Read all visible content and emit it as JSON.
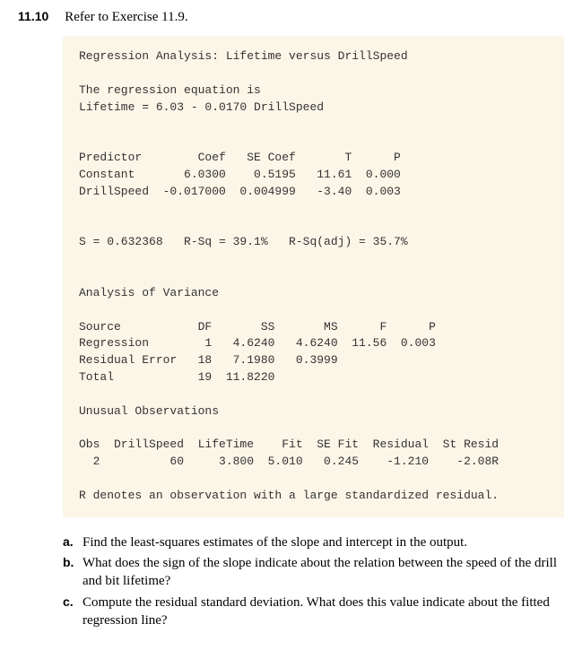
{
  "exercise": {
    "number": "11.10",
    "reference": "Refer to Exercise 11.9."
  },
  "output": {
    "title": "Regression Analysis: Lifetime versus DrillSpeed",
    "eq_label": "The regression equation is",
    "equation": "Lifetime = 6.03 - 0.0170 DrillSpeed",
    "pred_header": "Predictor        Coef   SE Coef       T      P",
    "pred_row1": "Constant       6.0300    0.5195   11.61  0.000",
    "pred_row2": "DrillSpeed  -0.017000  0.004999   -3.40  0.003",
    "summary": "S = 0.632368   R-Sq = 39.1%   R-Sq(adj) = 35.7%",
    "anova_title": "Analysis of Variance",
    "anova_header": "Source           DF       SS       MS      F      P",
    "anova_row1": "Regression        1   4.6240   4.6240  11.56  0.003",
    "anova_row2": "Residual Error   18   7.1980   0.3999",
    "anova_row3": "Total            19  11.8220",
    "unusual_title": "Unusual Observations",
    "unusual_header": "Obs  DrillSpeed  LifeTime    Fit  SE Fit  Residual  St Resid",
    "unusual_row1": "  2          60     3.800  5.010   0.245    -1.210    -2.08R",
    "footnote": "R denotes an observation with a large standardized residual."
  },
  "questions": {
    "a": {
      "letter": "a.",
      "text": "Find the least-squares estimates of the slope and intercept in the output."
    },
    "b": {
      "letter": "b.",
      "text": "What does the sign of the slope indicate about the relation between the speed of the drill and bit lifetime?"
    },
    "c": {
      "letter": "c.",
      "text": "Compute the residual standard deviation. What does this value indicate about the fitted regression line?"
    }
  }
}
